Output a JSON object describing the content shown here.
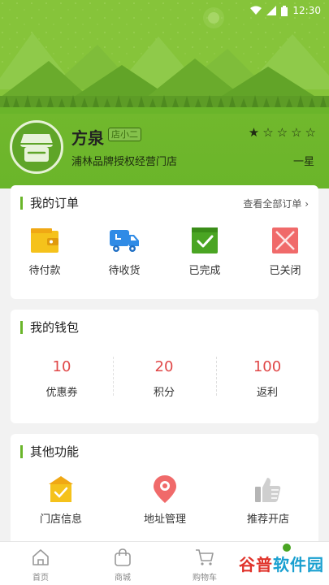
{
  "status_bar": {
    "time": "12:30"
  },
  "shop": {
    "name": "方泉",
    "tag": "店小二",
    "description": "浦林品牌授权经营门店",
    "rating_stars": 1,
    "rating_max": 5,
    "rating_text": "一星"
  },
  "orders": {
    "title": "我的订单",
    "view_all": "查看全部订单 ›",
    "items": [
      {
        "label": "待付款",
        "icon": "wallet-icon"
      },
      {
        "label": "待收货",
        "icon": "delivery-truck-icon"
      },
      {
        "label": "已完成",
        "icon": "completed-check-icon"
      },
      {
        "label": "已关闭",
        "icon": "closed-x-icon"
      }
    ]
  },
  "wallet": {
    "title": "我的钱包",
    "items": [
      {
        "value": "10",
        "label": "优惠券"
      },
      {
        "value": "20",
        "label": "积分"
      },
      {
        "value": "100",
        "label": "返利"
      }
    ]
  },
  "functions": {
    "title": "其他功能",
    "items": [
      {
        "label": "门店信息",
        "icon": "store-info-icon"
      },
      {
        "label": "地址管理",
        "icon": "location-pin-icon"
      },
      {
        "label": "推荐开店",
        "icon": "thumbs-up-icon"
      }
    ]
  },
  "tabbar": {
    "items": [
      {
        "label": "首页",
        "icon": "home-icon"
      },
      {
        "label": "商城",
        "icon": "shopping-bag-icon"
      },
      {
        "label": "购物车",
        "icon": "cart-icon"
      }
    ]
  },
  "watermark": {
    "text_a": "谷普",
    "text_b": "软件园"
  },
  "colors": {
    "accent": "#6ab52a",
    "value_red": "#e04848",
    "header_green": "#74b92e"
  }
}
